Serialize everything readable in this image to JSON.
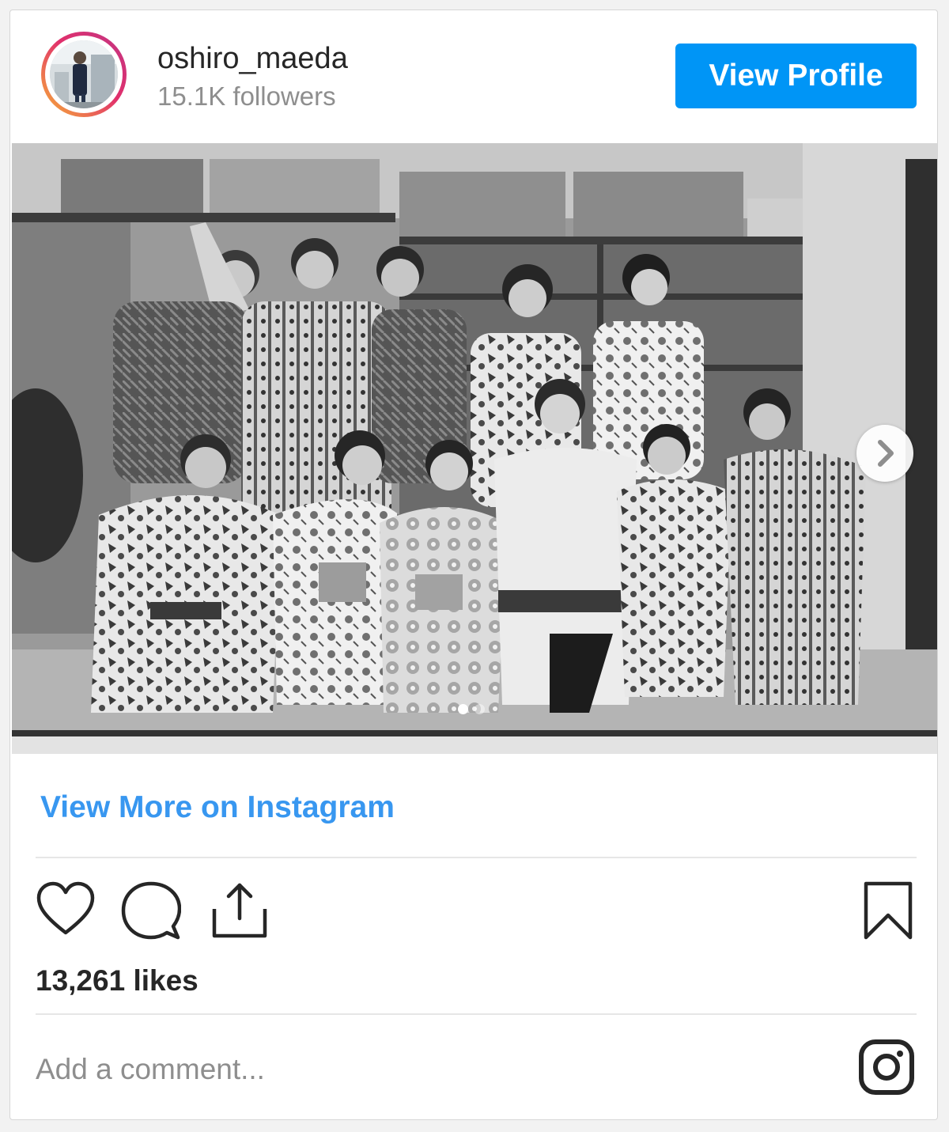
{
  "header": {
    "username": "oshiro_maeda",
    "followers": "15.1K followers",
    "view_profile_label": "View Profile"
  },
  "post": {
    "carousel_index": 1,
    "carousel_total": 2,
    "view_more_label": "View More on Instagram",
    "likes": "13,261 likes"
  },
  "comment": {
    "placeholder": "Add a comment..."
  },
  "colors": {
    "accent": "#0095f6",
    "link": "#3897f0",
    "text": "#262626",
    "muted": "#8e8e8e"
  },
  "icons": [
    "heart-icon",
    "comment-icon",
    "share-icon",
    "bookmark-icon",
    "instagram-icon",
    "chevron-right-icon"
  ]
}
